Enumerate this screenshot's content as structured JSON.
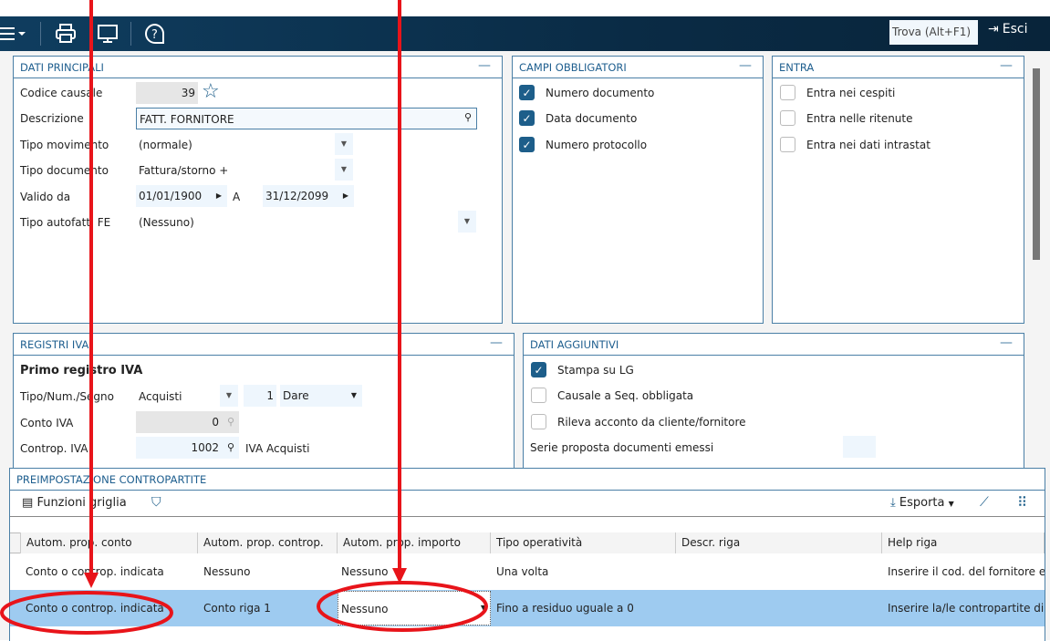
{
  "toolbar": {
    "find_placeholder": "Trova (Alt+F1)",
    "exit_label": "Esci"
  },
  "dati_principali": {
    "title": "DATI PRINCIPALI",
    "codice_label": "Codice causale",
    "codice_value": "39",
    "descrizione_label": "Descrizione",
    "descrizione_value": "FATT. FORNITORE",
    "tipo_mov_label": "Tipo movimento",
    "tipo_mov_value": "(normale)",
    "tipo_doc_label": "Tipo documento",
    "tipo_doc_value": "Fattura/storno +",
    "valido_label": "Valido da",
    "valido_da": "01/01/1900",
    "a_label": "A",
    "valido_a": "31/12/2099",
    "autofatt_label": "Tipo autofatt. FE",
    "autofatt_value": "(Nessuno)"
  },
  "campi_obbligatori": {
    "title": "CAMPI OBBLIGATORI",
    "items": [
      {
        "label": "Numero documento",
        "checked": true
      },
      {
        "label": "Data documento",
        "checked": true
      },
      {
        "label": "Numero protocollo",
        "checked": true
      }
    ]
  },
  "entra": {
    "title": "ENTRA",
    "items": [
      {
        "label": "Entra nei cespiti",
        "checked": false
      },
      {
        "label": "Entra nelle ritenute",
        "checked": false
      },
      {
        "label": "Entra nei dati intrastat",
        "checked": false
      }
    ]
  },
  "registri_iva": {
    "title": "REGISTRI IVA",
    "subtitle": "Primo registro IVA",
    "tipo_label": "Tipo/Num./Segno",
    "tipo_value": "Acquisti",
    "num_value": "1",
    "segno_value": "Dare",
    "conto_label": "Conto IVA",
    "conto_value": "0",
    "controp_label": "Controp. IVA",
    "controp_value": "1002",
    "controp_desc": "IVA Acquisti"
  },
  "dati_aggiuntivi": {
    "title": "DATI AGGIUNTIVI",
    "items": [
      {
        "label": "Stampa  su LG",
        "checked": true
      },
      {
        "label": "Causale a Seq. obbligata",
        "checked": false
      },
      {
        "label": "Rileva acconto da cliente/fornitore",
        "checked": false
      }
    ],
    "serie_label": "Serie proposta documenti emessi"
  },
  "preimpostazione": {
    "title": "PREIMPOSTAZIONE CONTROPARTITE",
    "funzioni_label": "Funzioni griglia",
    "esporta_label": "Esporta",
    "columns": [
      "Autom. prop. conto",
      "Autom. prop. controp.",
      "Autom. prop. importo",
      "Tipo operatività",
      "Descr. riga",
      "Help riga"
    ],
    "rows": [
      [
        "Conto o controp. indicata",
        "Nessuno",
        "Nessuno",
        "Una volta",
        "",
        "Inserire il cod. del fornitore ed"
      ],
      [
        "Conto o controp. indicata",
        "Conto riga 1",
        "Nessuno",
        "Fino a residuo uguale a 0",
        "",
        "Inserire la/le contropartite di co"
      ]
    ]
  },
  "colors": {
    "header": "#0f3d5f",
    "accent": "#1d5e8a",
    "selected_row": "#9ecbf0",
    "annotation": "#e8141a"
  }
}
